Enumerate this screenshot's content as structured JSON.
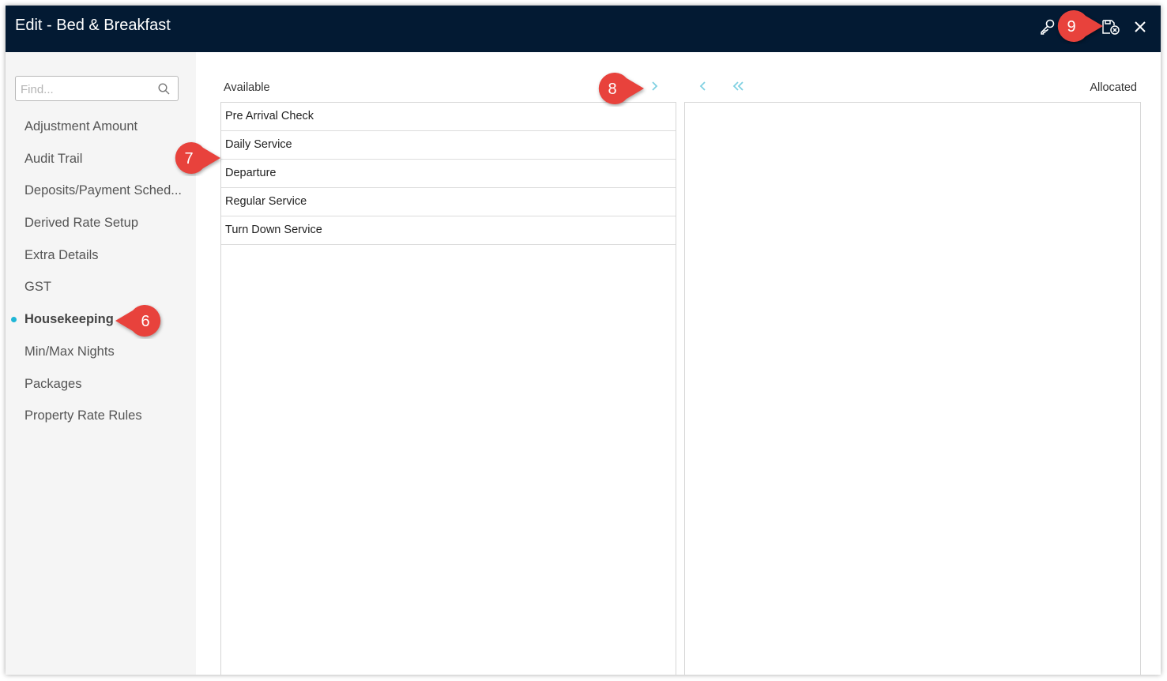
{
  "window": {
    "title": "Edit - Bed & Breakfast",
    "toolbar_icons": [
      "key-icon",
      "save-close-icon",
      "close-icon"
    ]
  },
  "sidebar": {
    "search_placeholder": "Find...",
    "items": [
      {
        "label": "Adjustment Amount"
      },
      {
        "label": "Audit Trail"
      },
      {
        "label": "Deposits/Payment Sched..."
      },
      {
        "label": "Derived Rate Setup"
      },
      {
        "label": "Extra Details"
      },
      {
        "label": "GST"
      },
      {
        "label": "Housekeeping",
        "active": true
      },
      {
        "label": "Min/Max Nights"
      },
      {
        "label": "Packages"
      },
      {
        "label": "Property Rate Rules"
      }
    ]
  },
  "main": {
    "available_label": "Available",
    "allocated_label": "Allocated",
    "available_items": [
      "Pre Arrival Check",
      "Daily Service",
      "Departure",
      "Regular Service",
      "Turn Down Service"
    ],
    "allocated_items": [],
    "transfer_icons": [
      "chevron-right-icon",
      "chevron-left-icon",
      "double-chevron-left-icon"
    ]
  },
  "callouts": [
    "6",
    "7",
    "8",
    "9"
  ],
  "colors": {
    "titlebar": "#031a33",
    "accent": "#1fb6d6",
    "callout": "#e8423c",
    "sidebar_bg": "#f5f5f5"
  }
}
